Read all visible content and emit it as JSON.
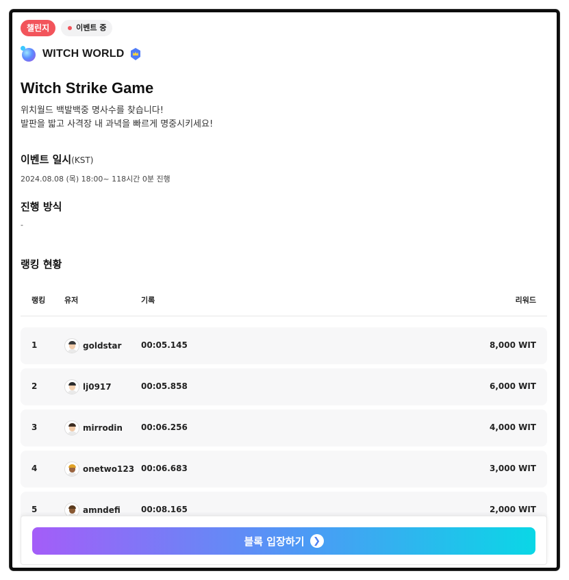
{
  "badges": {
    "challenge": "챌린지",
    "status": "이벤트 중"
  },
  "brand": {
    "name": "WITCH WORLD"
  },
  "event": {
    "title": "Witch Strike Game",
    "desc_line1": "위치월드 백발백중 명사수를 찾습니다!",
    "desc_line2": "발판을 밟고 사격장 내 과녁을 빠르게 명중시키세요!"
  },
  "schedule": {
    "heading": "이벤트 일시",
    "tz": "(KST)",
    "line": "2024.08.08 (목) 18:00~   118시간 0분 진행"
  },
  "method": {
    "heading": "진행 방식",
    "value": "-"
  },
  "ranking": {
    "heading": "랭킹 현황",
    "columns": {
      "rank": "랭킹",
      "user": "유저",
      "record": "기록",
      "reward": "리워드"
    },
    "rows": [
      {
        "rank": "1",
        "user": "goldstar",
        "record": "00:05.145",
        "reward": "8,000 WIT",
        "hair": "#3a3a3a",
        "skin": "#f1ccab"
      },
      {
        "rank": "2",
        "user": "lj0917",
        "record": "00:05.858",
        "reward": "6,000 WIT",
        "hair": "#2c2c2c",
        "skin": "#f4d1b0"
      },
      {
        "rank": "3",
        "user": "mirrodin",
        "record": "00:06.256",
        "reward": "4,000 WIT",
        "hair": "#3b2b20",
        "skin": "#f0c9a6"
      },
      {
        "rank": "4",
        "user": "onetwo123",
        "record": "00:06.683",
        "reward": "3,000 WIT",
        "hair": "#e0a227",
        "skin": "#9a6440"
      },
      {
        "rank": "5",
        "user": "amndefi",
        "record": "00:08.165",
        "reward": "2,000 WIT",
        "hair": "#5a3a1d",
        "skin": "#8a5a34"
      }
    ]
  },
  "cta": {
    "label": "블록 입장하기",
    "icon": "chevron-right-icon"
  },
  "colors": {
    "accent_red": "#f2545b",
    "cta_start": "#a45df8",
    "cta_end": "#0ad7e6"
  }
}
